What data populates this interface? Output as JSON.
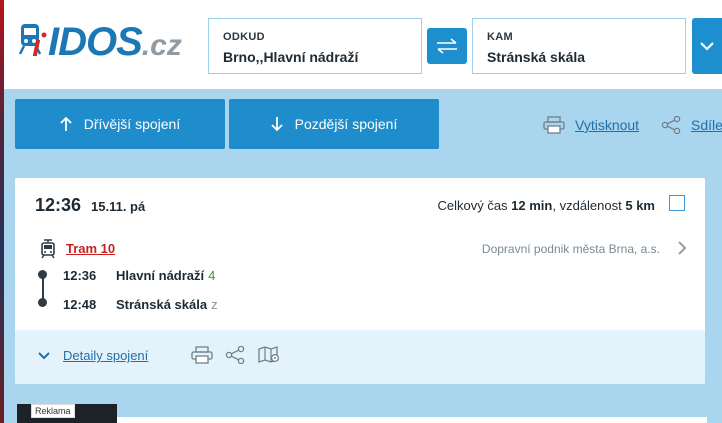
{
  "logo": {
    "text": "IDOS",
    "suffix": ".cz"
  },
  "search": {
    "from_label": "ODKUD",
    "from_value": "Brno,,Hlavní nádraží",
    "to_label": "KAM",
    "to_value": "Stránská skála"
  },
  "nav": {
    "earlier_label": "Dřívější spojení",
    "later_label": "Pozdější spojení",
    "print_label": "Vytisknout",
    "share_label": "Sdílet"
  },
  "connection": {
    "departure_time": "12:36",
    "date": "15.11. pá",
    "summary_prefix": "Celkový čas ",
    "total_time": "12 min",
    "summary_mid": ", vzdálenost ",
    "distance": "5 km",
    "line_name": "Tram 10",
    "operator": "Dopravní podnik města Brna, a.s.",
    "stops": [
      {
        "time": "12:36",
        "name": "Hlavní nádraží",
        "platform": "4",
        "platform_color": "#3a9a3a"
      },
      {
        "time": "12:48",
        "name": "Stránská skála",
        "platform": "z",
        "platform_color": "#8a949a"
      }
    ],
    "details_label": "Detaily spojení"
  },
  "ad": {
    "label": "Reklama"
  },
  "colors": {
    "accent": "#1f8dcc",
    "background": "#a9d5ee",
    "line_red": "#cc1f1f",
    "link": "#1f6fa8"
  }
}
